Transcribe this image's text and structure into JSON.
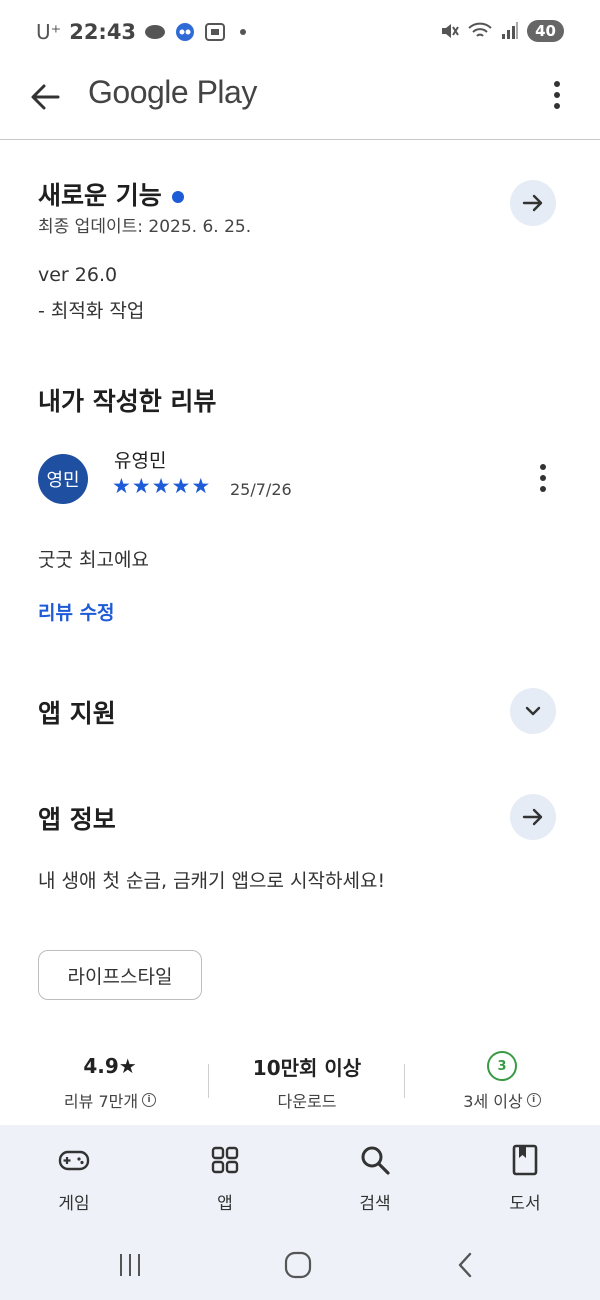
{
  "status_bar": {
    "carrier": "U⁺",
    "time": "22:43",
    "battery": "40"
  },
  "app_bar": {
    "title": "Google Play"
  },
  "whats_new": {
    "title": "새로운 기능",
    "updated": "최종 업데이트: 2025. 6. 25.",
    "version": "ver 26.0",
    "notes": "- 최적화 작업"
  },
  "my_review": {
    "section_title": "내가 작성한 리뷰",
    "avatar_text": "영민",
    "author": "유영민",
    "rating": 5,
    "date": "25/7/26",
    "text": "굿굿 최고에요",
    "edit_link": "리뷰 수정"
  },
  "app_support": {
    "title": "앱 지원"
  },
  "app_info": {
    "title": "앱 정보",
    "description": "내 생애 첫 순금, 금캐기 앱으로 시작하세요!",
    "category_chip": "라이프스타일"
  },
  "stats": {
    "rating_value": "4.9★",
    "rating_label": "리뷰 7만개",
    "downloads_value": "10만회 이상",
    "downloads_label": "다운로드",
    "age_value": "3",
    "age_label": "3세 이상"
  },
  "bottom_nav": {
    "items": [
      {
        "label": "게임",
        "icon": "gamepad-icon"
      },
      {
        "label": "앱",
        "icon": "apps-grid-icon"
      },
      {
        "label": "검색",
        "icon": "search-icon"
      },
      {
        "label": "도서",
        "icon": "book-icon"
      }
    ]
  },
  "colors": {
    "accent": "#1e5bd6",
    "avatar_bg": "#1f4fa0",
    "age_green": "#3a9a44",
    "nav_bg": "#eef2f8"
  }
}
